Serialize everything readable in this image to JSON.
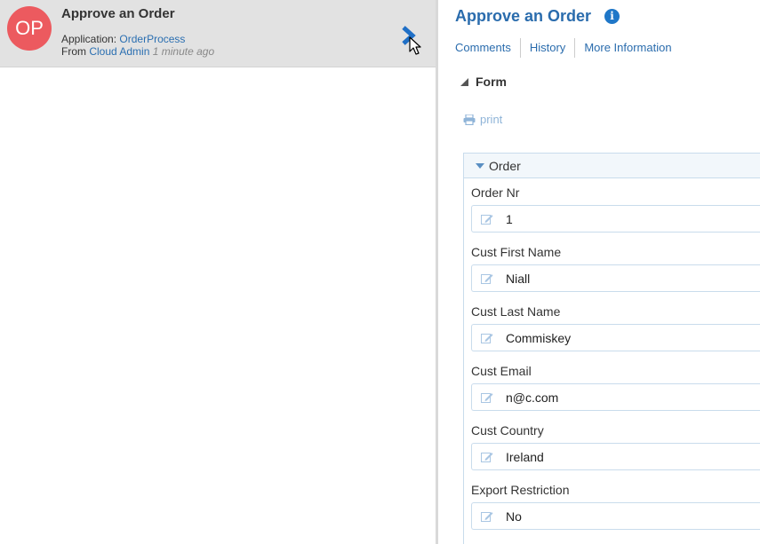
{
  "task": {
    "avatar_initials": "OP",
    "title": "Approve an Order",
    "application_label": "Application:",
    "application_value": "OrderProcess",
    "from_label": "From",
    "from_value": "Cloud Admin",
    "time_ago": "1 minute ago"
  },
  "detail": {
    "title": "Approve an Order",
    "info_icon": "i",
    "tabs": [
      {
        "label": "Comments"
      },
      {
        "label": "History"
      },
      {
        "label": "More Information"
      }
    ],
    "form_label": "Form",
    "print_label": "print",
    "section_title": "Order",
    "fields": [
      {
        "label": "Order Nr",
        "value": "1"
      },
      {
        "label": "Cust First Name",
        "value": "Niall"
      },
      {
        "label": "Cust Last Name",
        "value": "Commiskey"
      },
      {
        "label": "Cust Email",
        "value": "n@c.com"
      },
      {
        "label": "Cust Country",
        "value": "Ireland"
      },
      {
        "label": "Export Restriction",
        "value": "No"
      }
    ]
  },
  "colors": {
    "avatar_bg": "#ec5a5f",
    "link": "#2b6fb1",
    "title": "#2a6cad",
    "info_icon": "#1f77c8",
    "selected_row_bg": "#e2e2e2"
  },
  "icons": [
    "chevron-right-icon",
    "mouse-cursor-icon",
    "info-icon",
    "collapse-triangle-icon",
    "printer-icon",
    "expand-triangle-icon",
    "edit-icon"
  ]
}
